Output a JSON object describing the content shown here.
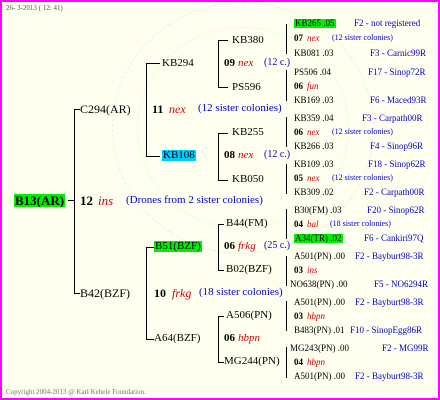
{
  "header": {
    "date": "26-  3-2013 ( 12: 41)"
  },
  "footer": {
    "copyright": "Copyright 2004-2013 @ Karl Kehele Foundation."
  },
  "root": {
    "label": "B13(AR)",
    "num": "12",
    "name": "ins",
    "note": "(Drones from 2 sister colonies)"
  },
  "upper": {
    "label": "C294(AR)",
    "num": "11",
    "name": "nex",
    "note": "(12 sister colonies)",
    "kb294": {
      "label": "KB294",
      "num": "09",
      "name": "nex",
      "note": "(12 c.)",
      "kb380": "KB380",
      "ps596": "PS596",
      "r1": {
        "a": "KB265 .05",
        "b": "F2 - not registered"
      },
      "r2": {
        "num": "07",
        "name": "nex",
        "note": "(12 sister colonies)"
      },
      "r3": {
        "a": "KB081 .03",
        "b": "F3 - Carnic99R"
      },
      "r4": {
        "a": "PS506 .04",
        "b": "F17 - Sinop72R"
      },
      "r5": {
        "num": "06",
        "name": "fun"
      },
      "r6": {
        "a": "KB169 .03",
        "b": "F6 - Maced93R"
      }
    },
    "kb108": {
      "label": "KB108",
      "num": "08",
      "name": "nex",
      "note": "(12 c.)",
      "kb255": "KB255",
      "kb050": "KB050",
      "r1": {
        "a": "KB359 .04",
        "b": "F3 - Carpath00R"
      },
      "r2": {
        "num": "06",
        "name": "nex",
        "note": "(12 sister colonies)"
      },
      "r3": {
        "a": "KB266 .03",
        "b": "F4 - Sinop96R"
      },
      "r4": {
        "a": "KB109 .03",
        "b": "F18 - Sinop62R"
      },
      "r5": {
        "num": "05",
        "name": "nex",
        "note": "(12 sister colonies)"
      },
      "r6": {
        "a": "KB309 .02",
        "b": "F2 - Carpath00R"
      }
    }
  },
  "lower": {
    "label": "B42(BZF)",
    "num": "10",
    "name": "frkg",
    "note": "(18 sister colonies)",
    "b51": {
      "label": "B51(BZF)",
      "num": "06",
      "name": "frkg",
      "note": "(25 c.)",
      "b44": "B44(FM)",
      "b02": "B02(BZF)",
      "r1": {
        "a": "B30(FM) .03",
        "b": "F20 - Sinop62R"
      },
      "r2": {
        "num": "04",
        "name": "bal",
        "note": "(18 sister colonies)"
      },
      "r3": {
        "a": "A34(TR) .02",
        "b": "F6 - Cankiri97Q"
      },
      "r4": {
        "a": "A501(PN) .00",
        "b": "F2 - Bayburt98-3R"
      },
      "r5": {
        "num": "03",
        "name": "ins"
      },
      "r6": {
        "a": "NO638(PN) .00",
        "b": "F5 - NO6294R"
      }
    },
    "a64": {
      "label": "A64(BZF)",
      "a506": "A506(PN)",
      "num": "06",
      "name": "hbpn",
      "mg244": "MG244(PN)",
      "r1": {
        "a": "A501(PN) .00",
        "b": "F2 - Bayburt98-3R"
      },
      "r2": {
        "num": "03",
        "name": "hbpn"
      },
      "r3": {
        "a": "B483(PN) .01",
        "b": "F10 - SinopEgg86R"
      },
      "r4": {
        "a": "MG243(PN) .00",
        "b": "F2 - MG99R"
      },
      "r5": {
        "num": "04",
        "name": "hbpn"
      },
      "r6": {
        "a": "A501(PN) .00",
        "b": "F2 - Bayburt98-3R"
      }
    }
  }
}
